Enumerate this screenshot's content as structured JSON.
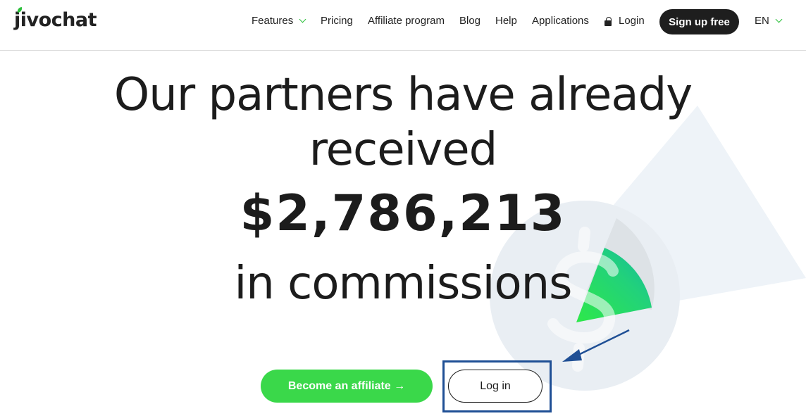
{
  "brand": {
    "logo_text": "jivochat",
    "accent": "#3ad84a",
    "dark": "#1e1e1e",
    "highlight_frame": "#1f4f95"
  },
  "nav": {
    "features": "Features",
    "pricing": "Pricing",
    "affiliate": "Affiliate program",
    "blog": "Blog",
    "help": "Help",
    "applications": "Applications",
    "login": "Login",
    "signup": "Sign up free",
    "language": "EN"
  },
  "hero": {
    "line1": "Our partners have already",
    "line2": "received",
    "amount": "$2,786,213",
    "line3": "in commissions"
  },
  "cta": {
    "affiliate": "Become an affiliate →",
    "login": "Log in"
  },
  "icons": [
    "chevron-down-icon",
    "lock-icon",
    "dollar-coin-illustration",
    "arrow-annotation"
  ]
}
